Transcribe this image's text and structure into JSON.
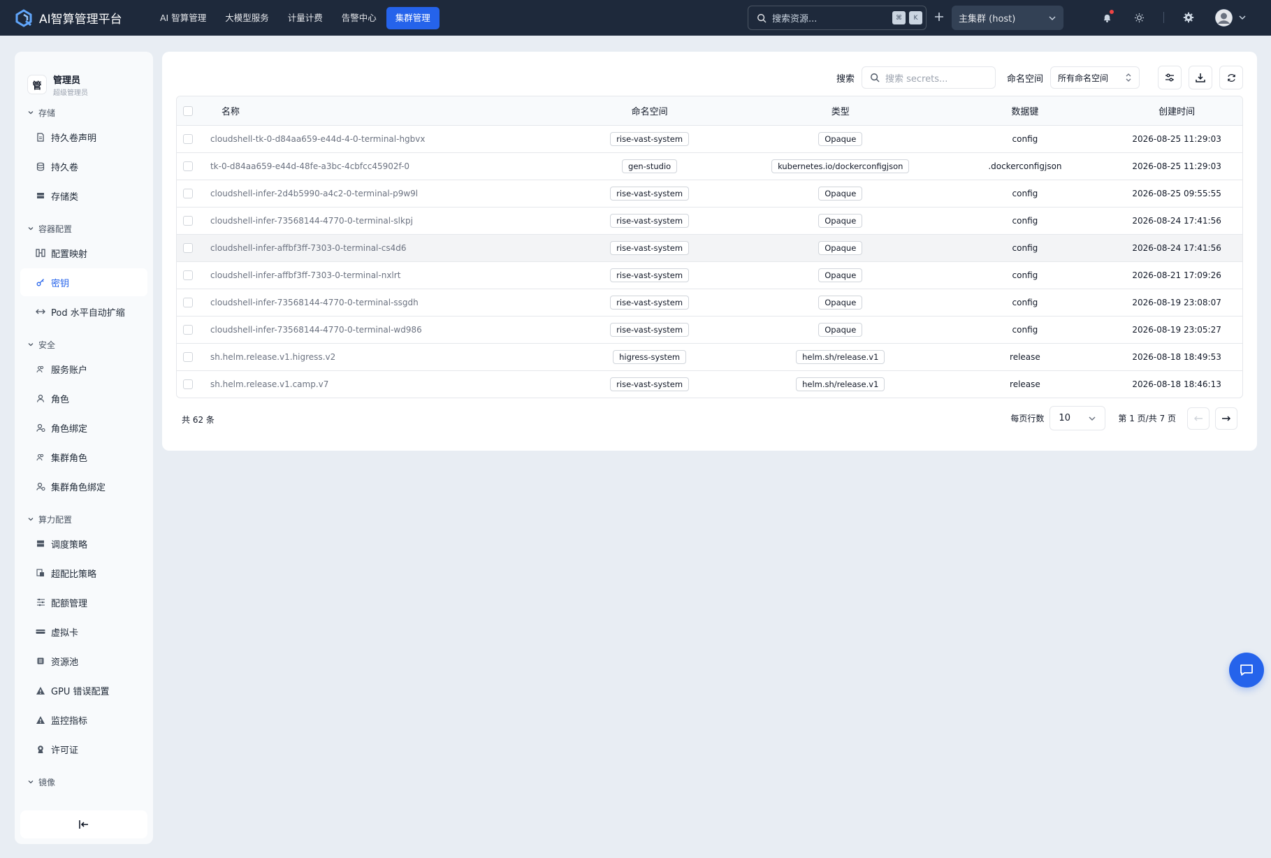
{
  "app": {
    "title": "AI智算管理平台"
  },
  "nav": [
    {
      "label": "AI 智算管理",
      "active": false
    },
    {
      "label": "大模型服务",
      "active": false
    },
    {
      "label": "计量计费",
      "active": false
    },
    {
      "label": "告警中心",
      "active": false
    },
    {
      "label": "集群管理",
      "active": true
    }
  ],
  "topbar": {
    "search_placeholder": "搜索资源...",
    "kbd1": "⌘",
    "kbd2": "K",
    "cluster": "主集群 (host)"
  },
  "user": {
    "avatar_text": "管",
    "name": "管理员",
    "role": "超级管理员"
  },
  "sidebar": {
    "groups": [
      {
        "label": "存储",
        "items": [
          {
            "label": "持久卷声明",
            "icon": "file-icon"
          },
          {
            "label": "持久卷",
            "icon": "database-icon"
          },
          {
            "label": "存储类",
            "icon": "storage-icon"
          }
        ]
      },
      {
        "label": "容器配置",
        "items": [
          {
            "label": "配置映射",
            "icon": "config-map-icon"
          },
          {
            "label": "密钥",
            "icon": "key-icon",
            "active": true
          },
          {
            "label": "Pod 水平自动扩缩",
            "icon": "arrows-horizontal-icon"
          }
        ]
      },
      {
        "label": "安全",
        "items": [
          {
            "label": "服务账户",
            "icon": "users-icon"
          },
          {
            "label": "角色",
            "icon": "user-icon"
          },
          {
            "label": "角色绑定",
            "icon": "user-link-icon"
          },
          {
            "label": "集群角色",
            "icon": "users-icon"
          },
          {
            "label": "集群角色绑定",
            "icon": "user-link-icon"
          }
        ]
      },
      {
        "label": "算力配置",
        "items": [
          {
            "label": "调度策略",
            "icon": "server-icon"
          },
          {
            "label": "超配比策略",
            "icon": "ratio-icon"
          },
          {
            "label": "配额管理",
            "icon": "sliders-icon"
          },
          {
            "label": "虚拟卡",
            "icon": "card-icon"
          },
          {
            "label": "资源池",
            "icon": "pool-icon"
          },
          {
            "label": "GPU 错误配置",
            "icon": "warning-icon"
          },
          {
            "label": "监控指标",
            "icon": "warning-icon"
          },
          {
            "label": "许可证",
            "icon": "license-icon"
          }
        ]
      },
      {
        "label": "镜像",
        "items": []
      }
    ]
  },
  "toolbar": {
    "search_label": "搜索",
    "search_placeholder": "搜索 secrets...",
    "namespace_label": "命名空间",
    "namespace_value": "所有命名空间"
  },
  "table": {
    "columns": [
      "名称",
      "命名空间",
      "类型",
      "数据键",
      "创建时间"
    ],
    "rows": [
      {
        "name": "cloudshell-tk-0-d84aa659-e44d-4-0-terminal-hgbvx",
        "namespace": "rise-vast-system",
        "type": "Opaque",
        "keys": "config",
        "created": "2026-08-25 11:29:03"
      },
      {
        "name": "tk-0-d84aa659-e44d-48fe-a3bc-4cbfcc45902f-0",
        "namespace": "gen-studio",
        "type": "kubernetes.io/dockerconfigjson",
        "keys": ".dockerconfigjson",
        "created": "2026-08-25 11:29:03"
      },
      {
        "name": "cloudshell-infer-2d4b5990-a4c2-0-terminal-p9w9l",
        "namespace": "rise-vast-system",
        "type": "Opaque",
        "keys": "config",
        "created": "2026-08-25 09:55:55"
      },
      {
        "name": "cloudshell-infer-73568144-4770-0-terminal-slkpj",
        "namespace": "rise-vast-system",
        "type": "Opaque",
        "keys": "config",
        "created": "2026-08-24 17:41:56"
      },
      {
        "name": "cloudshell-infer-affbf3ff-7303-0-terminal-cs4d6",
        "namespace": "rise-vast-system",
        "type": "Opaque",
        "keys": "config",
        "created": "2026-08-24 17:41:56"
      },
      {
        "name": "cloudshell-infer-affbf3ff-7303-0-terminal-nxlrt",
        "namespace": "rise-vast-system",
        "type": "Opaque",
        "keys": "config",
        "created": "2026-08-21 17:09:26"
      },
      {
        "name": "cloudshell-infer-73568144-4770-0-terminal-ssgdh",
        "namespace": "rise-vast-system",
        "type": "Opaque",
        "keys": "config",
        "created": "2026-08-19 23:08:07"
      },
      {
        "name": "cloudshell-infer-73568144-4770-0-terminal-wd986",
        "namespace": "rise-vast-system",
        "type": "Opaque",
        "keys": "config",
        "created": "2026-08-19 23:05:27"
      },
      {
        "name": "sh.helm.release.v1.higress.v2",
        "namespace": "higress-system",
        "type": "helm.sh/release.v1",
        "keys": "release",
        "created": "2026-08-18 18:49:53"
      },
      {
        "name": "sh.helm.release.v1.camp.v7",
        "namespace": "rise-vast-system",
        "type": "helm.sh/release.v1",
        "keys": "release",
        "created": "2026-08-18 18:46:13"
      }
    ]
  },
  "pagination": {
    "total": "共 62 条",
    "rows_per_page_label": "每页行数",
    "rows_per_page": "10",
    "page_info": "第 1 页/共 7 页"
  },
  "colors": {
    "accent": "#2563eb",
    "topbar": "#1e293b",
    "background": "#e8edf3"
  }
}
